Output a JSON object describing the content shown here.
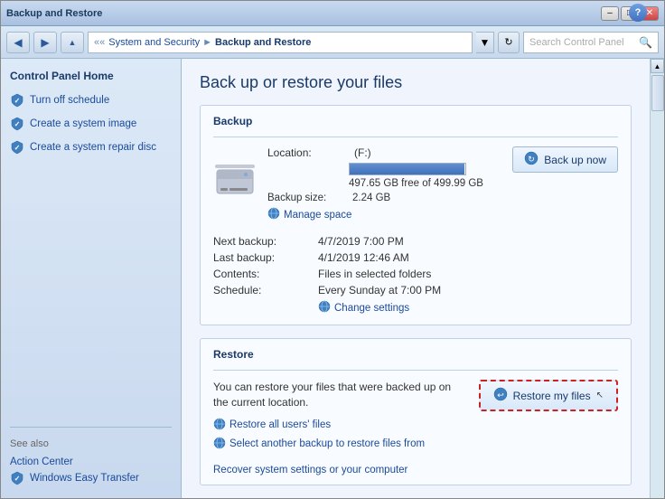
{
  "window": {
    "title": "Backup and Restore"
  },
  "titlebar": {
    "minimize": "–",
    "maximize": "□",
    "close": "✕"
  },
  "addressbar": {
    "back_tooltip": "Back",
    "forward_tooltip": "Forward",
    "breadcrumb": {
      "part1": "System and Security",
      "part2": "Backup and Restore"
    },
    "search_placeholder": "Search Control Panel"
  },
  "sidebar": {
    "title": "Control Panel Home",
    "links": [
      {
        "label": "Turn off schedule"
      },
      {
        "label": "Create a system image"
      },
      {
        "label": "Create a system repair disc"
      }
    ],
    "see_also": {
      "title": "See also",
      "links": [
        {
          "label": "Action Center"
        },
        {
          "label": "Windows Easy Transfer"
        }
      ]
    }
  },
  "content": {
    "page_title": "Back up or restore your files",
    "backup_section": {
      "title": "Backup",
      "location_label": "Location:",
      "location_value": "(F:)",
      "disk_free": "497.65 GB free of 499.99 GB",
      "backup_size_label": "Backup size:",
      "backup_size_value": "2.24 GB",
      "manage_space_label": "Manage space",
      "back_up_now_label": "Back up now",
      "next_backup_label": "Next backup:",
      "next_backup_value": "4/7/2019 7:00 PM",
      "last_backup_label": "Last backup:",
      "last_backup_value": "4/1/2019 12:46 AM",
      "contents_label": "Contents:",
      "contents_value": "Files in selected folders",
      "schedule_label": "Schedule:",
      "schedule_value": "Every Sunday at 7:00 PM",
      "change_settings_label": "Change settings"
    },
    "restore_section": {
      "title": "Restore",
      "description": "You can restore your files that were backed up on the current location.",
      "restore_my_files_label": "Restore my files",
      "restore_all_users_label": "Restore all users' files",
      "select_another_label": "Select another backup to restore files from",
      "recover_system_label": "Recover system settings or your computer"
    }
  }
}
